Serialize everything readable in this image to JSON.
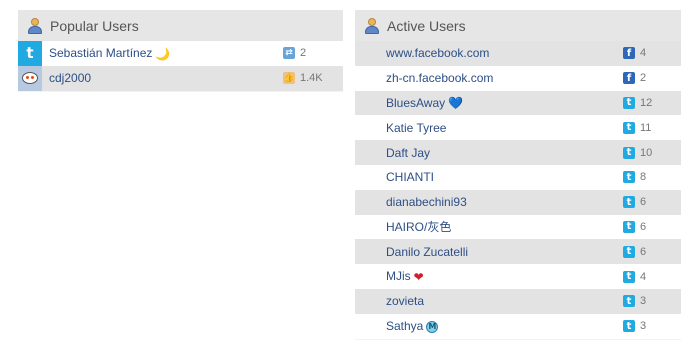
{
  "popular": {
    "title": "Popular Users",
    "users": [
      {
        "service": "twitter-icon",
        "name": "Sebastián Martínez",
        "emoji": "🌙",
        "stat_icon": "retweet-icon",
        "stat": "2"
      },
      {
        "service": "reddit-icon",
        "name": "cdj2000",
        "emoji": "",
        "stat_icon": "like-icon",
        "stat": "1.4K"
      }
    ]
  },
  "active": {
    "title": "Active Users",
    "users": [
      {
        "service": "facebook-icon",
        "name": "www.facebook.com",
        "emoji": "",
        "stat_icon": "facebook-icon",
        "stat": "4"
      },
      {
        "service": "facebook-icon",
        "name": "zh-cn.facebook.com",
        "emoji": "",
        "stat_icon": "facebook-icon",
        "stat": "2"
      },
      {
        "service": "twitter-icon",
        "name": "BluesAway",
        "emoji": "💙",
        "stat_icon": "twitter-icon",
        "stat": "12"
      },
      {
        "service": "twitter-icon",
        "name": "Katie Tyree",
        "emoji": "",
        "stat_icon": "twitter-icon",
        "stat": "11"
      },
      {
        "service": "twitter-icon",
        "name": "Daft Jay",
        "emoji": "",
        "stat_icon": "twitter-icon",
        "stat": "10"
      },
      {
        "service": "twitter-icon",
        "name": "CHIANTI",
        "emoji": "",
        "stat_icon": "twitter-icon",
        "stat": "8"
      },
      {
        "service": "twitter-icon",
        "name": "dianabechini93",
        "emoji": "",
        "stat_icon": "twitter-icon",
        "stat": "6"
      },
      {
        "service": "twitter-icon",
        "name": "HAIRO/灰色",
        "emoji": "",
        "stat_icon": "twitter-icon",
        "stat": "6"
      },
      {
        "service": "twitter-icon",
        "name": "Danilo Zucatelli",
        "emoji": "",
        "stat_icon": "twitter-icon",
        "stat": "6"
      },
      {
        "service": "twitter-icon",
        "name": "MJis",
        "emoji": "❤",
        "stat_icon": "twitter-icon",
        "stat": "4"
      },
      {
        "service": "twitter-icon",
        "name": "zovieta",
        "emoji": "",
        "stat_icon": "twitter-icon",
        "stat": "3"
      },
      {
        "service": "twitter-icon",
        "name": "Sathya",
        "emoji": "Ⓜ",
        "stat_icon": "twitter-icon",
        "stat": "3"
      }
    ]
  },
  "colors": {
    "twitter": "#21a9e1",
    "facebook": "#2f67b8",
    "link": "#2d4f86",
    "header_bg": "#e6e6e6"
  }
}
